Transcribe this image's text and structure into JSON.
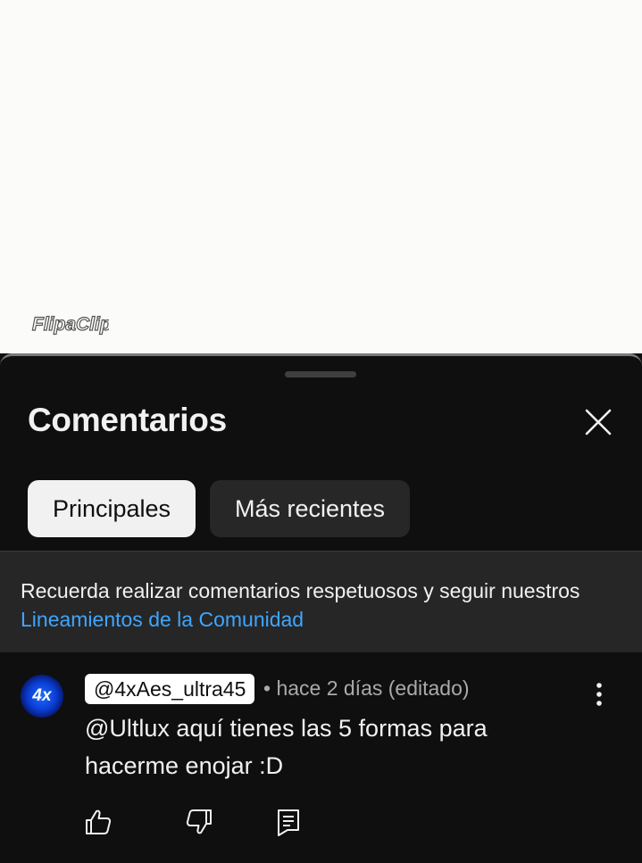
{
  "video": {
    "watermark_text": "FlipaClip"
  },
  "sheet": {
    "title": "Comentarios",
    "close_icon": "close-icon"
  },
  "filters": {
    "top_label": "Principales",
    "newest_label": "Más recientes"
  },
  "notice": {
    "text": "Recuerda realizar comentarios respetuosos y seguir nuestros",
    "link_text": "Lineamientos de la Comunidad"
  },
  "comment": {
    "avatar_text": "4x",
    "author": "@4xAes_ultra45",
    "meta": "• hace 2 días (editado)",
    "text": "@Ultlux aquí tienes las 5 formas para hacerme enojar :D",
    "more_icon": "more-vertical-icon",
    "like_icon": "thumb-up-icon",
    "dislike_icon": "thumb-down-icon",
    "reply_icon": "reply-icon"
  },
  "colors": {
    "background": "#0f0f0f",
    "link": "#3ea6ff",
    "chip_active": "#f1f1f1",
    "chip_inactive": "#272727",
    "notice_bg": "#262626"
  }
}
